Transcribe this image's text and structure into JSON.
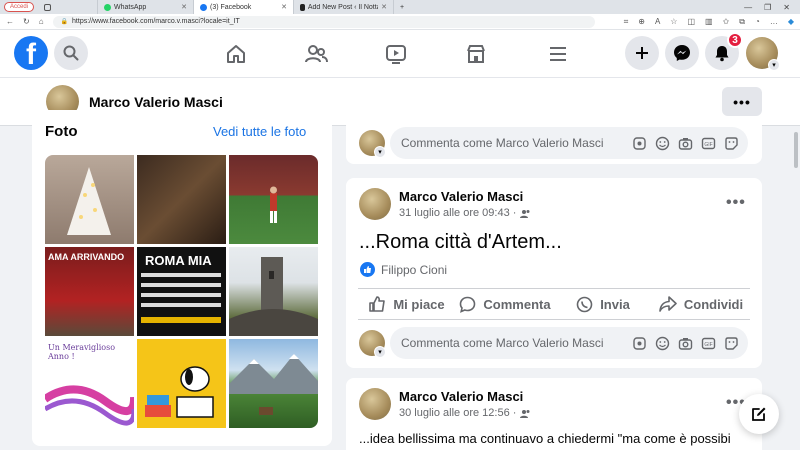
{
  "browser": {
    "login_pill": "Accedi",
    "tabs": [
      {
        "label": "WhatsApp",
        "active": false,
        "icon": "whatsapp-icon"
      },
      {
        "label": "(3) Facebook",
        "active": true,
        "icon": "facebook-icon"
      },
      {
        "label": "Add New Post ‹ Il Nottalista — W",
        "active": false,
        "icon": "wordpress-icon"
      }
    ],
    "new_tab": "+",
    "url": "https://www.facebook.com/marco.v.masci?locale=it_IT"
  },
  "nav": {
    "logo": "f",
    "notification_count": "3"
  },
  "profile": {
    "name": "Marco Valerio Masci",
    "more": "•••"
  },
  "photos": {
    "title": "Foto",
    "see_all": "Vedi tutte le foto",
    "items": [
      {
        "name": "photo-christmas-tree"
      },
      {
        "name": "photo-group-crowd"
      },
      {
        "name": "photo-stadium-player"
      },
      {
        "name": "photo-santa-run",
        "caption": "AMA ARRIVANDO"
      },
      {
        "name": "photo-roma-mia",
        "caption": "ROMA MIA"
      },
      {
        "name": "photo-stone-tower"
      },
      {
        "name": "photo-meraviglioso-anno",
        "caption": "Un Meraviglioso Anno !"
      },
      {
        "name": "photo-snoopy-books"
      },
      {
        "name": "photo-mountain-meadow"
      }
    ]
  },
  "feed": {
    "comment_placeholder": "Commenta come Marco Valerio Masci",
    "post1": {
      "author": "Marco Valerio Masci",
      "date": "31 luglio alle ore 09:43 ·",
      "text": "...Roma città d'Artem...",
      "liker": "Filippo Cioni",
      "actions": {
        "like": "Mi piace",
        "comment": "Commenta",
        "send": "Invia",
        "share": "Condividi"
      }
    },
    "post2": {
      "author": "Marco Valerio Masci",
      "date": "30 luglio alle ore 12:56 ·",
      "text": "...idea bellissima ma continuavo a chiedermi \"ma come è possibile"
    }
  }
}
